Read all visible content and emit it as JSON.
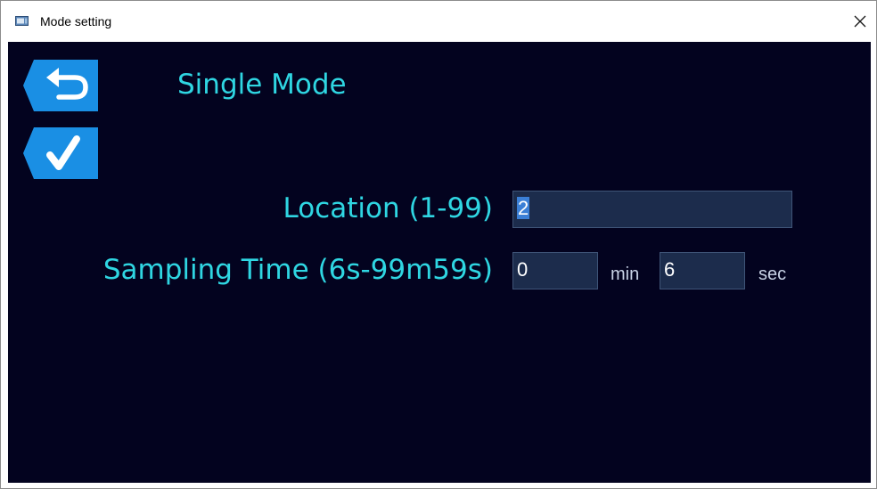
{
  "window": {
    "title": "Mode setting",
    "close_glyph": "✕"
  },
  "icons": {
    "app": "app-window-icon",
    "back": "back-arrow-icon",
    "confirm": "checkmark-icon",
    "close": "close-icon"
  },
  "colors": {
    "background": "#03031f",
    "accent_text": "#2fd6e2",
    "button_fill": "#1a8fe4",
    "input_fill": "#1c2c4c",
    "selection": "#3b7fd6"
  },
  "mode": {
    "title": "Single Mode"
  },
  "form": {
    "location": {
      "label": "Location (1-99)",
      "value": "2"
    },
    "sampling": {
      "label": "Sampling Time (6s-99m59s)",
      "min_value": "0",
      "min_unit": "min",
      "sec_value": "6",
      "sec_unit": "sec"
    }
  }
}
